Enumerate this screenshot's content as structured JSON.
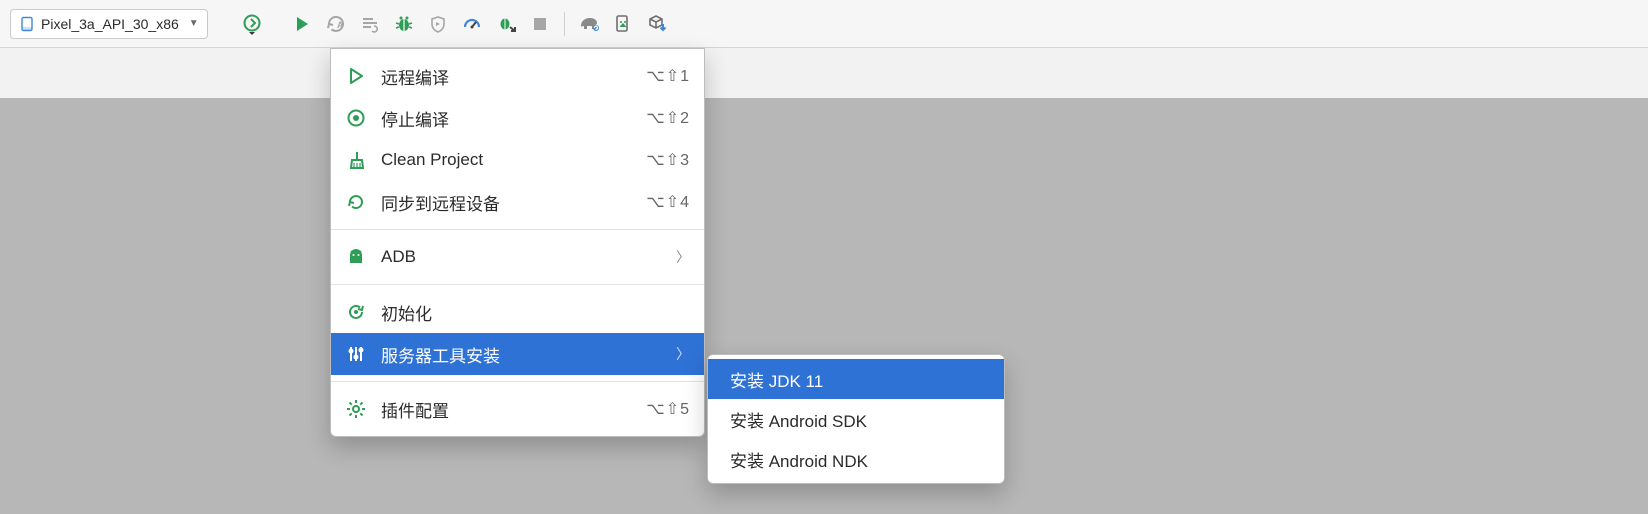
{
  "toolbar": {
    "device_selected": "Pixel_3a_API_30_x86"
  },
  "menu": {
    "items": [
      {
        "label": "远程编译",
        "shortcut": "⌥⇧1"
      },
      {
        "label": "停止编译",
        "shortcut": "⌥⇧2"
      },
      {
        "label": "Clean Project",
        "shortcut": "⌥⇧3"
      },
      {
        "label": "同步到远程设备",
        "shortcut": "⌥⇧4"
      },
      {
        "label": "ADB"
      },
      {
        "label": "初始化"
      },
      {
        "label": "服务器工具安装"
      },
      {
        "label": "插件配置",
        "shortcut": "⌥⇧5"
      }
    ]
  },
  "submenu": {
    "items": [
      {
        "label": "安装 JDK 11"
      },
      {
        "label": "安装 Android SDK"
      },
      {
        "label": "安装 Android NDK"
      }
    ]
  }
}
